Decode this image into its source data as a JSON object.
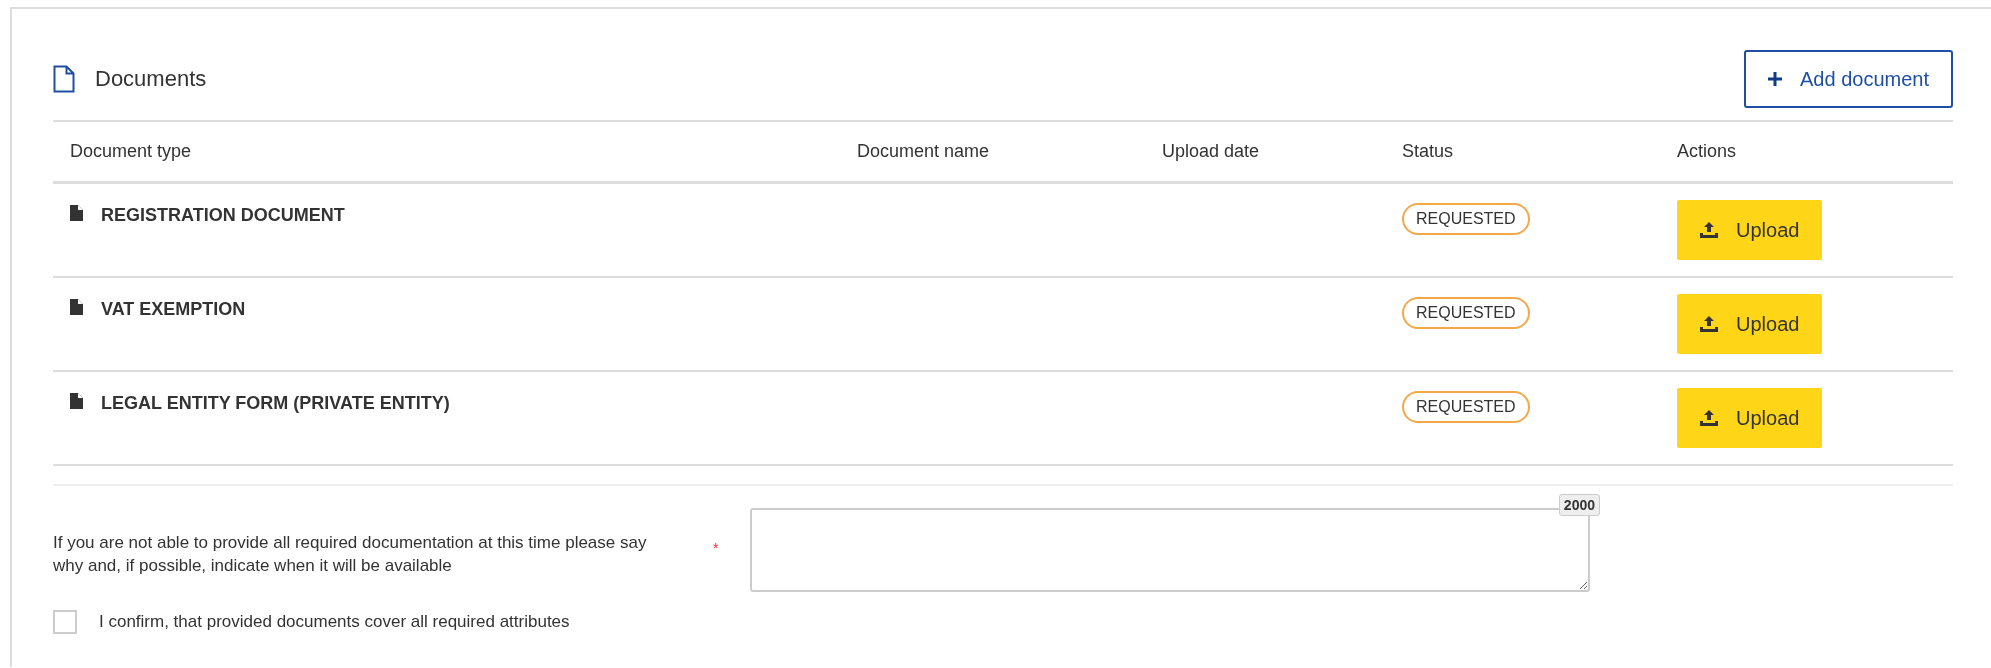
{
  "panel": {
    "title": "Documents",
    "add_button": "Add document"
  },
  "table": {
    "columns": [
      "Document type",
      "Document name",
      "Upload date",
      "Status",
      "Actions"
    ],
    "rows": [
      {
        "type": "REGISTRATION DOCUMENT",
        "status": "REQUESTED",
        "action": "Upload"
      },
      {
        "type": "VAT EXEMPTION",
        "status": "REQUESTED",
        "action": "Upload"
      },
      {
        "type": "LEGAL ENTITY FORM (PRIVATE ENTITY)",
        "status": "REQUESTED",
        "action": "Upload"
      }
    ]
  },
  "explanation": {
    "label": "If you are not able to provide all required documentation at this time please say why and, if possible, indicate when it will be available",
    "required": true,
    "required_mark": "*",
    "counter": "2000"
  },
  "confirm": {
    "label": "I confirm, that provided documents cover all required attributes",
    "checked": false
  }
}
